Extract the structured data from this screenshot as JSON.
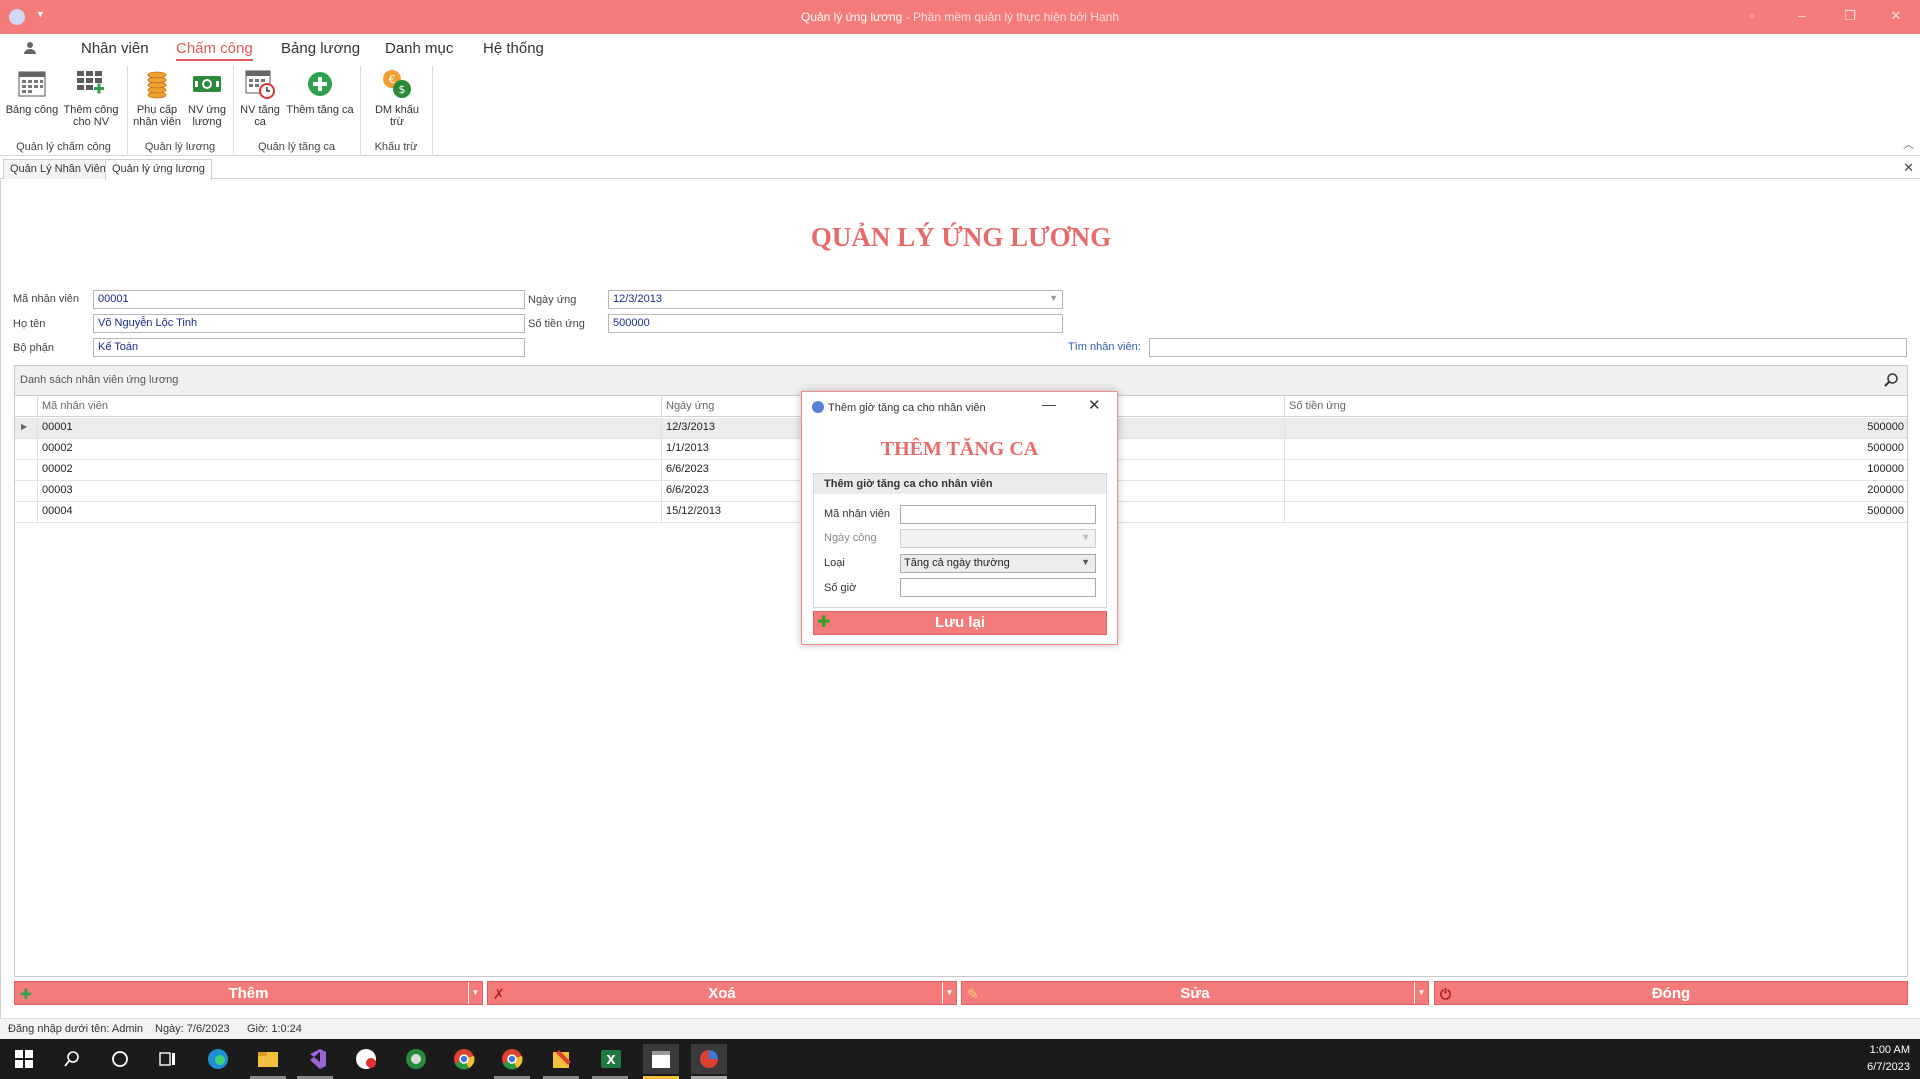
{
  "window": {
    "title": "Quản lý ứng lương",
    "title_suffix": " - Phần mềm quản lý thực hiện bởi Hạnh"
  },
  "ribbon": {
    "tabs": [
      "Nhân viên",
      "Chấm công",
      "Bảng lương",
      "Danh mục",
      "Hệ thống"
    ],
    "active_tab": "Chấm công",
    "buttons": {
      "bang_cong": "Bảng công",
      "them_cong_1": "Thêm công",
      "them_cong_2": "cho NV",
      "phu_cap_1": "Phụ cấp",
      "phu_cap_2": "nhân viên",
      "nv_ung_1": "NV ứng",
      "nv_ung_2": "lương",
      "nv_tang_1": "NV tăng",
      "nv_tang_2": "ca",
      "them_tang_ca": "Thêm tăng ca",
      "dm_khau_1": "DM khấu",
      "dm_khau_2": "trừ"
    },
    "groups": {
      "cham_cong": "Quản lý chấm công",
      "luong": "Quản lý lương",
      "tang_ca": "Quản lý tăng ca",
      "khau_tru": "Khấu trừ"
    }
  },
  "doc_tabs": [
    "Quản Lý Nhân Viên",
    "Quản lý ứng lương"
  ],
  "page": {
    "heading": "QUẢN LÝ ỨNG LƯƠNG",
    "form": {
      "ma_nv_label": "Mã nhân viên",
      "ma_nv_value": "00001",
      "ho_ten_label": "Họ tên",
      "ho_ten_value": "Võ Nguyễn Lộc Tinh",
      "bo_phan_label": "Bộ phận",
      "bo_phan_value": "Kế Toán",
      "ngay_ung_label": "Ngày ứng",
      "ngay_ung_value": "12/3/2013",
      "so_tien_label": "Số tiền ứng",
      "so_tien_value": "500000",
      "tim_label": "Tìm nhân viên:",
      "tim_value": ""
    },
    "grid": {
      "caption": "Danh sách nhân viên ứng lương",
      "columns": [
        "Mã nhân viên",
        "Ngày ứng",
        "Số tiền ứng"
      ],
      "rows": [
        {
          "ma": "00001",
          "ngay": "12/3/2013",
          "tien": "500000"
        },
        {
          "ma": "00002",
          "ngay": "1/1/2013",
          "tien": "500000"
        },
        {
          "ma": "00002",
          "ngay": "6/6/2023",
          "tien": "100000"
        },
        {
          "ma": "00003",
          "ngay": "6/6/2023",
          "tien": "200000"
        },
        {
          "ma": "00004",
          "ngay": "15/12/2013",
          "tien": "500000"
        }
      ]
    },
    "actions": {
      "them": "Thêm",
      "xoa": "Xoá",
      "sua": "Sửa",
      "dong": "Đóng"
    }
  },
  "dialog": {
    "title": "Thêm giờ tăng ca cho nhân viên",
    "heading": "THÊM TĂNG CA",
    "group_caption": "Thêm giờ tăng ca cho nhân viên",
    "ma_nv_label": "Mã nhân viên",
    "ma_nv_value": "",
    "ngay_cong_label": "Ngày công",
    "ngay_cong_value": "",
    "loai_label": "Loại",
    "loai_value": "Tăng cả ngày thường",
    "so_gio_label": "Số giờ",
    "so_gio_value": "",
    "save_label": "Lưu lại"
  },
  "status": {
    "user": "Đăng nhập dưới tên: Admin",
    "date": "Ngày: 7/6/2023",
    "time": "Giờ: 1:0:24"
  },
  "taskbar": {
    "time": "1:00 AM",
    "date": "6/7/2023"
  },
  "colors": {
    "accent": "#f57a7a",
    "heading": "#e86a6a"
  }
}
